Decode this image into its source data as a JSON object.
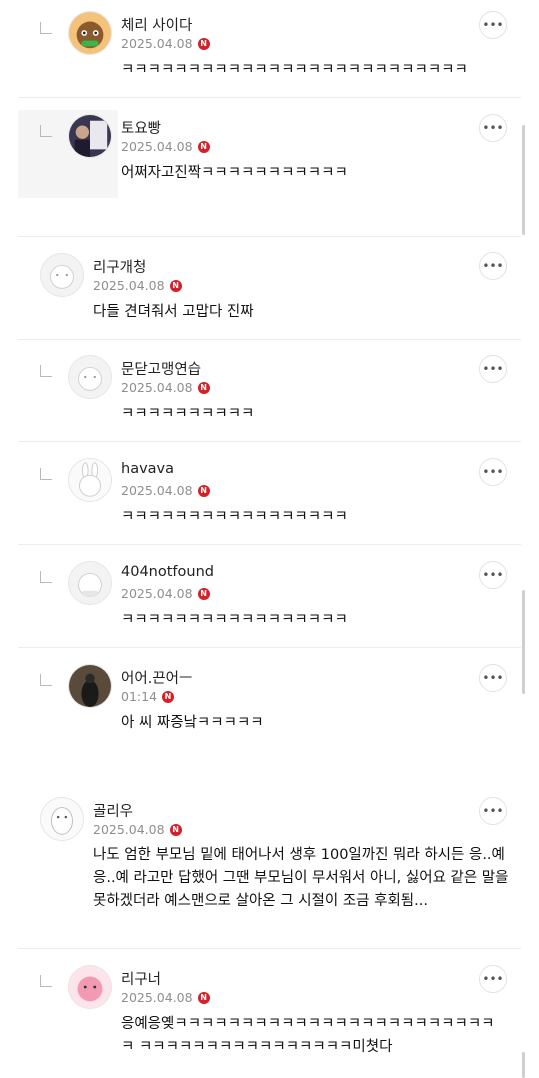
{
  "comments": [
    {
      "nickname": "체리 사이다",
      "date": "2025.04.08",
      "badge": "N",
      "text": "ㅋㅋㅋㅋㅋㅋㅋㅋㅋㅋㅋㅋㅋㅋㅋㅋㅋㅋㅋㅋㅋㅋㅋㅋㅋㅋ",
      "avatar_icon": "character-avatar-icon"
    },
    {
      "nickname": "토요빵",
      "date": "2025.04.08",
      "badge": "N",
      "text": "어쩌자고진짝ㅋㅋㅋㅋㅋㅋㅋㅋㅋㅋㅋ",
      "avatar_icon": "photo-avatar-icon"
    },
    {
      "nickname": "리구개청",
      "date": "2025.04.08",
      "badge": "N",
      "text": "다들 견뎌줘서 고맙다 진짜",
      "avatar_icon": "default-avatar-icon"
    },
    {
      "nickname": "문닫고맹연습",
      "date": "2025.04.08",
      "badge": "N",
      "text": "ㅋㅋㅋㅋㅋㅋㅋㅋㅋㅋ",
      "avatar_icon": "default-avatar-icon"
    },
    {
      "nickname": "havava",
      "date": "2025.04.08",
      "badge": "N",
      "text": "ㅋㅋㅋㅋㅋㅋㅋㅋㅋㅋㅋㅋㅋㅋㅋㅋㅋ",
      "avatar_icon": "rabbit-avatar-icon"
    },
    {
      "nickname": "404notfound",
      "date": "2025.04.08",
      "badge": "N",
      "text": "ㅋㅋㅋㅋㅋㅋㅋㅋㅋㅋㅋㅋㅋㅋㅋㅋㅋ",
      "avatar_icon": "hamster-avatar-icon"
    },
    {
      "nickname": "어어.끈어ㅡ",
      "date": "01:14",
      "badge": "N",
      "text": "아 씨 짜증낰ㅋㅋㅋㅋㅋ",
      "avatar_icon": "photo-avatar-icon"
    },
    {
      "nickname": "골리우",
      "date": "2025.04.08",
      "badge": "N",
      "text": "나도 엄한 부모님 밑에 태어나서 생후 100일까진 뭐라 하시든 응..예 응..예 라고만 답했어 그땐 부모님이 무서워서 아니, 싫어요 같은 말을 못하겠더라 예스맨으로 살아온 그 시절이 조금 후회됨...",
      "avatar_icon": "penguin-avatar-icon"
    },
    {
      "nickname": "리구너",
      "date": "2025.04.08",
      "badge": "N",
      "text": "응예응옞ㅋㅋㅋㅋㅋㅋㅋㅋㅋㅋㅋㅋㅋㅋㅋㅋㅋㅋㅋㅋㅋㅋㅋㅋㅋ ㅋㅋㅋㅋㅋㅋㅋㅋㅋㅋㅋㅋㅋㅋㅋㅋ미쳣다",
      "avatar_icon": "pink-character-avatar-icon"
    }
  ],
  "more_label": "•••"
}
